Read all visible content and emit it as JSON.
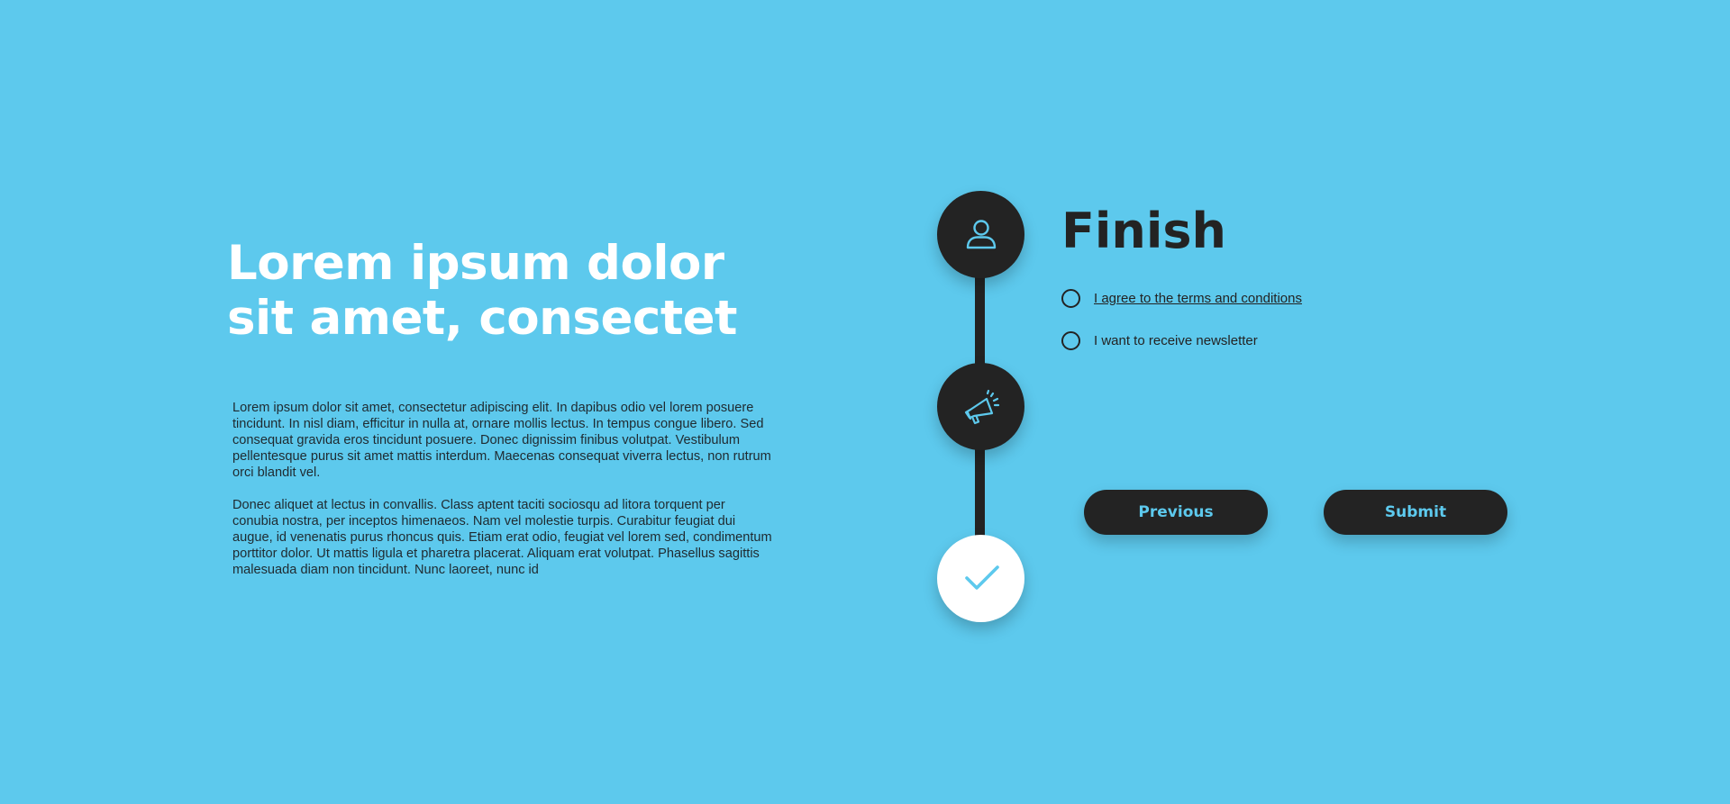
{
  "intro": {
    "headline": "Lorem ipsum dolor sit amet, consectet",
    "paragraphs": [
      "Lorem ipsum dolor sit amet, consectetur adipiscing elit. In dapibus odio vel lorem posuere tincidunt. In nisl diam, efficitur in nulla at, ornare mollis lectus. In tempus congue libero. Sed consequat gravida eros tincidunt posuere. Donec dignissim finibus volutpat. Vestibulum pellentesque purus sit amet mattis interdum. Maecenas consequat viverra lectus, non rutrum orci blandit vel.",
      "Donec aliquet at lectus in convallis. Class aptent taciti sociosqu ad litora torquent per conubia nostra, per inceptos himenaeos. Nam vel molestie turpis. Curabitur feugiat dui augue, id venenatis purus rhoncus quis. Etiam erat odio, feugiat vel lorem sed, condimentum porttitor dolor. Ut mattis ligula et pharetra placerat. Aliquam erat volutpat. Phasellus sagittis malesuada diam non tincidunt. Nunc laoreet, nunc id"
    ]
  },
  "stepper": {
    "steps": [
      {
        "icon": "user-icon",
        "state": "completed"
      },
      {
        "icon": "megaphone-icon",
        "state": "completed"
      },
      {
        "icon": "checkmark-icon",
        "state": "current"
      }
    ]
  },
  "form": {
    "title": "Finish",
    "options": [
      {
        "label": "I agree to the terms and conditions",
        "checked": false
      },
      {
        "label": "I want to receive newsletter",
        "checked": false
      }
    ],
    "previous_label": "Previous",
    "submit_label": "Submit"
  },
  "colors": {
    "background": "#5dc9ed",
    "dark": "#232323",
    "accent": "#5dc9ed",
    "white": "#ffffff"
  }
}
